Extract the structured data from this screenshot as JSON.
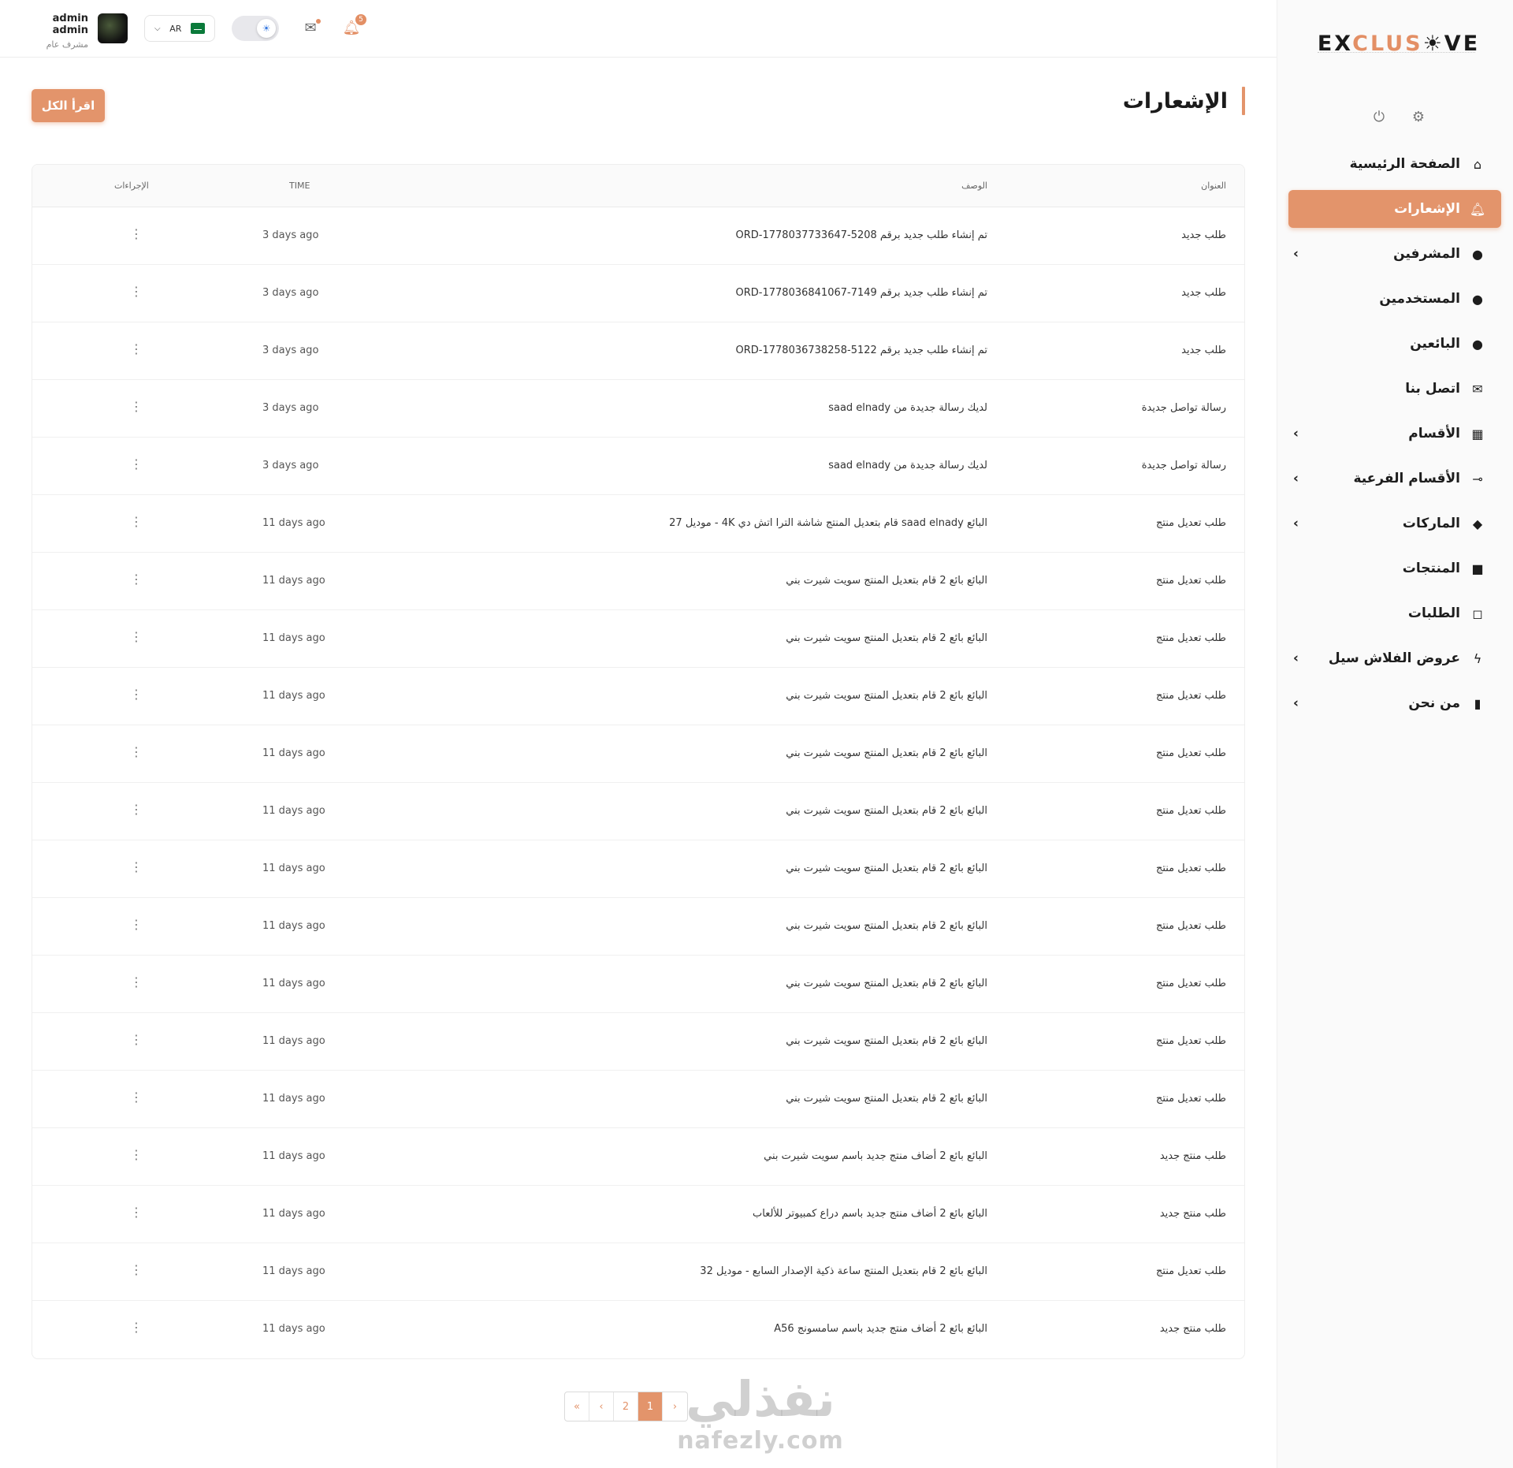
{
  "user": {
    "name": "admin admin",
    "role": "مشرف عام"
  },
  "lang": {
    "code": "AR"
  },
  "notifications_count": "5",
  "brand": {
    "logo_text_1": "EX",
    "logo_text_2": "CLUS",
    "logo_text_3": "☀VE"
  },
  "sidebar": {
    "items": [
      {
        "label": "الصفحة الرئيسية",
        "icon": "home-icon",
        "glyph": "⌂",
        "chevron": false
      },
      {
        "label": "الإشعارات",
        "icon": "bell-icon",
        "glyph": "🔔︎",
        "chevron": false,
        "active": true
      },
      {
        "label": "المشرفين",
        "icon": "user-icon",
        "glyph": "●",
        "chevron": true
      },
      {
        "label": "المستخدمين",
        "icon": "user-icon",
        "glyph": "●",
        "chevron": false
      },
      {
        "label": "البائعين",
        "icon": "user-icon",
        "glyph": "●",
        "chevron": false
      },
      {
        "label": "اتصل بنا",
        "icon": "envelope-icon",
        "glyph": "✉",
        "chevron": false
      },
      {
        "label": "الأقسام",
        "icon": "grid-icon",
        "glyph": "▦",
        "chevron": true
      },
      {
        "label": "الأقسام الفرعية",
        "icon": "key-icon",
        "glyph": "⊸",
        "chevron": true
      },
      {
        "label": "الماركات",
        "icon": "tag-icon",
        "glyph": "◆",
        "chevron": true
      },
      {
        "label": "المنتجات",
        "icon": "box-icon",
        "glyph": "■",
        "chevron": false
      },
      {
        "label": "الطلبات",
        "icon": "bag-icon",
        "glyph": "◻",
        "chevron": false
      },
      {
        "label": "عروض الفلاش سيل",
        "icon": "bolt-icon",
        "glyph": "ϟ",
        "chevron": true
      },
      {
        "label": "من نحن",
        "icon": "book-icon",
        "glyph": "▮",
        "chevron": true
      }
    ]
  },
  "page": {
    "title": "الإشعارات",
    "read_all": "اقرأ الكل"
  },
  "table": {
    "headers": {
      "title": "العنوان",
      "desc": "الوصف",
      "time": "TIME",
      "actions": "الإجراءات"
    },
    "rows": [
      {
        "title": "طلب جديد",
        "desc": "تم إنشاء طلب جديد برقم ORD-1778037733647-5208",
        "time": "3 days ago"
      },
      {
        "title": "طلب جديد",
        "desc": "تم إنشاء طلب جديد برقم ORD-1778036841067-7149",
        "time": "3 days ago"
      },
      {
        "title": "طلب جديد",
        "desc": "تم إنشاء طلب جديد برقم ORD-1778036738258-5122",
        "time": "3 days ago"
      },
      {
        "title": "رسالة تواصل جديدة",
        "desc": "لديك رسالة جديدة من saad elnady",
        "time": "3 days ago"
      },
      {
        "title": "رسالة تواصل جديدة",
        "desc": "لديك رسالة جديدة من saad elnady",
        "time": "3 days ago"
      },
      {
        "title": "طلب تعديل منتج",
        "desc": "البائع saad elnady قام بتعديل المنتج شاشة الترا اتش دي 4K - موديل 27",
        "time": "11 days ago"
      },
      {
        "title": "طلب تعديل منتج",
        "desc": "البائع بائع 2 قام بتعديل المنتج سويت شيرت بني",
        "time": "11 days ago"
      },
      {
        "title": "طلب تعديل منتج",
        "desc": "البائع بائع 2 قام بتعديل المنتج سويت شيرت بني",
        "time": "11 days ago"
      },
      {
        "title": "طلب تعديل منتج",
        "desc": "البائع بائع 2 قام بتعديل المنتج سويت شيرت بني",
        "time": "11 days ago"
      },
      {
        "title": "طلب تعديل منتج",
        "desc": "البائع بائع 2 قام بتعديل المنتج سويت شيرت بني",
        "time": "11 days ago"
      },
      {
        "title": "طلب تعديل منتج",
        "desc": "البائع بائع 2 قام بتعديل المنتج سويت شيرت بني",
        "time": "11 days ago"
      },
      {
        "title": "طلب تعديل منتج",
        "desc": "البائع بائع 2 قام بتعديل المنتج سويت شيرت بني",
        "time": "11 days ago"
      },
      {
        "title": "طلب تعديل منتج",
        "desc": "البائع بائع 2 قام بتعديل المنتج سويت شيرت بني",
        "time": "11 days ago"
      },
      {
        "title": "طلب تعديل منتج",
        "desc": "البائع بائع 2 قام بتعديل المنتج سويت شيرت بني",
        "time": "11 days ago"
      },
      {
        "title": "طلب تعديل منتج",
        "desc": "البائع بائع 2 قام بتعديل المنتج سويت شيرت بني",
        "time": "11 days ago"
      },
      {
        "title": "طلب تعديل منتج",
        "desc": "البائع بائع 2 قام بتعديل المنتج سويت شيرت بني",
        "time": "11 days ago"
      },
      {
        "title": "طلب منتج جديد",
        "desc": "البائع بائع 2 أضاف منتج جديد باسم سويت شيرت بني",
        "time": "11 days ago"
      },
      {
        "title": "طلب منتج جديد",
        "desc": "البائع بائع 2 أضاف منتج جديد باسم دراع كمبيوتر للألعاب",
        "time": "11 days ago"
      },
      {
        "title": "طلب تعديل منتج",
        "desc": "البائع بائع 2 قام بتعديل المنتج ساعة ذكية الإصدار السابع - موديل 32",
        "time": "11 days ago"
      },
      {
        "title": "طلب منتج جديد",
        "desc": "البائع بائع 2 أضاف منتج جديد باسم سامسونج A56",
        "time": "11 days ago"
      }
    ]
  },
  "pagination": {
    "first": "«",
    "prev": "‹",
    "page2": "2",
    "page1": "1",
    "next": "›"
  },
  "watermark": {
    "ar": "نفذلي",
    "en": "nafezly.com"
  },
  "colors": {
    "accent": "#e3946b"
  }
}
